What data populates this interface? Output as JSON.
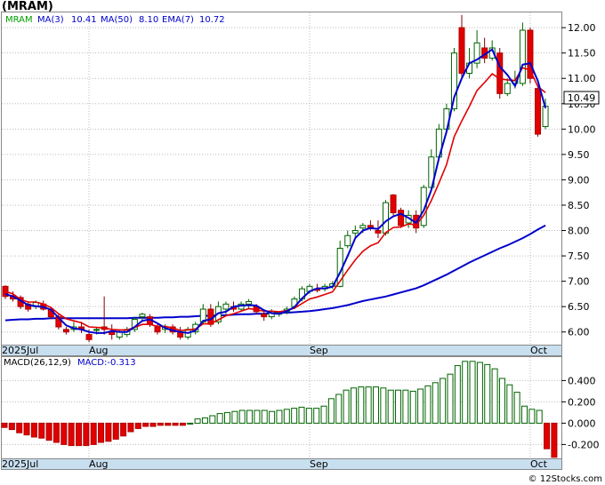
{
  "title": "(MRAM)",
  "watermark": "© 12Stocks.com",
  "colors": {
    "up": "#00a000",
    "down": "#e00000",
    "ma_fast": "#0000cc",
    "ma_slow": "#0000cc",
    "ema": "#e00000",
    "macd_pos": "#006400",
    "macd_neg": "#e00000",
    "axis_band": "#c8dff0",
    "grid": "#bbbbbb"
  },
  "chart_data": [
    {
      "type": "candlestick",
      "title": "(MRAM)",
      "legend": [
        {
          "label": "MRAM",
          "value": "",
          "color": "#00a000"
        },
        {
          "label": "MA(3)",
          "value": "10.41",
          "color": "#0000cc"
        },
        {
          "label": "MA(50)",
          "value": "8.10",
          "color": "#0000cc"
        },
        {
          "label": "EMA(7)",
          "value": "10.72",
          "color": "#0000cc"
        }
      ],
      "last_price": "10.49",
      "ylim": [
        5.75,
        12.3
      ],
      "y_ticks": [
        "6.00",
        "6.50",
        "7.00",
        "7.50",
        "8.00",
        "8.50",
        "9.00",
        "9.50",
        "10.00",
        "10.50",
        "11.00",
        "11.50",
        "12.00"
      ],
      "x_labels": [
        {
          "label": "2025Jul",
          "index": 0
        },
        {
          "label": "Aug",
          "index": 11
        },
        {
          "label": "Sep",
          "index": 40
        },
        {
          "label": "Oct",
          "index": 69
        }
      ],
      "ohlc": [
        [
          6.9,
          6.92,
          6.65,
          6.7
        ],
        [
          6.72,
          6.8,
          6.6,
          6.65
        ],
        [
          6.68,
          6.72,
          6.45,
          6.5
        ],
        [
          6.55,
          6.6,
          6.4,
          6.45
        ],
        [
          6.5,
          6.62,
          6.45,
          6.58
        ],
        [
          6.55,
          6.62,
          6.42,
          6.45
        ],
        [
          6.45,
          6.5,
          6.25,
          6.3
        ],
        [
          6.3,
          6.35,
          6.05,
          6.1
        ],
        [
          6.05,
          6.1,
          5.95,
          6.0
        ],
        [
          6.05,
          6.2,
          6.0,
          6.1
        ],
        [
          6.1,
          6.2,
          5.98,
          6.05
        ],
        [
          5.95,
          6.05,
          5.8,
          5.85
        ],
        [
          6.05,
          6.1,
          5.95,
          6.05
        ],
        [
          6.1,
          6.7,
          5.95,
          6.05
        ],
        [
          6.0,
          6.15,
          5.85,
          5.95
        ],
        [
          5.9,
          6.05,
          5.85,
          6.0
        ],
        [
          5.95,
          6.1,
          5.9,
          6.05
        ],
        [
          6.05,
          6.3,
          6.0,
          6.25
        ],
        [
          6.3,
          6.38,
          6.2,
          6.35
        ],
        [
          6.3,
          6.35,
          6.1,
          6.15
        ],
        [
          6.1,
          6.15,
          5.95,
          6.0
        ],
        [
          6.05,
          6.15,
          5.98,
          6.1
        ],
        [
          6.1,
          6.15,
          5.95,
          6.0
        ],
        [
          6.0,
          6.1,
          5.85,
          5.9
        ],
        [
          5.9,
          6.1,
          5.85,
          6.05
        ],
        [
          6.0,
          6.2,
          5.95,
          6.15
        ],
        [
          6.2,
          6.55,
          6.15,
          6.45
        ],
        [
          6.45,
          6.55,
          6.1,
          6.15
        ],
        [
          6.2,
          6.6,
          6.15,
          6.5
        ],
        [
          6.45,
          6.6,
          6.35,
          6.55
        ],
        [
          6.5,
          6.6,
          6.4,
          6.45
        ],
        [
          6.45,
          6.6,
          6.4,
          6.55
        ],
        [
          6.55,
          6.65,
          6.45,
          6.6
        ],
        [
          6.5,
          6.55,
          6.35,
          6.4
        ],
        [
          6.35,
          6.4,
          6.22,
          6.3
        ],
        [
          6.3,
          6.45,
          6.25,
          6.4
        ],
        [
          6.35,
          6.4,
          6.3,
          6.38
        ],
        [
          6.4,
          6.5,
          6.35,
          6.45
        ],
        [
          6.5,
          6.7,
          6.45,
          6.65
        ],
        [
          6.65,
          6.9,
          6.6,
          6.85
        ],
        [
          6.8,
          6.95,
          6.75,
          6.9
        ],
        [
          6.85,
          6.95,
          6.78,
          6.82
        ],
        [
          6.85,
          6.95,
          6.8,
          6.9
        ],
        [
          6.9,
          7.0,
          6.85,
          6.95
        ],
        [
          6.9,
          7.8,
          6.88,
          7.65
        ],
        [
          7.7,
          8.0,
          7.65,
          7.9
        ],
        [
          7.95,
          8.1,
          7.85,
          8.0
        ],
        [
          8.05,
          8.15,
          7.95,
          8.1
        ],
        [
          8.1,
          8.2,
          8.0,
          8.05
        ],
        [
          8.0,
          8.2,
          7.85,
          7.95
        ],
        [
          7.95,
          8.6,
          7.9,
          8.55
        ],
        [
          8.7,
          8.72,
          8.3,
          8.35
        ],
        [
          8.4,
          8.45,
          8.05,
          8.1
        ],
        [
          8.15,
          8.4,
          8.05,
          8.3
        ],
        [
          8.3,
          8.4,
          7.95,
          8.05
        ],
        [
          8.1,
          8.9,
          8.05,
          8.85
        ],
        [
          8.85,
          9.6,
          8.8,
          9.45
        ],
        [
          9.45,
          10.1,
          9.4,
          10.0
        ],
        [
          10.0,
          10.5,
          9.95,
          10.4
        ],
        [
          10.4,
          11.6,
          10.35,
          11.5
        ],
        [
          12.0,
          12.25,
          11.0,
          11.1
        ],
        [
          11.1,
          11.6,
          11.0,
          11.3
        ],
        [
          11.3,
          11.95,
          11.2,
          11.7
        ],
        [
          11.6,
          11.8,
          11.3,
          11.4
        ],
        [
          11.4,
          11.75,
          11.35,
          11.6
        ],
        [
          11.5,
          11.6,
          10.6,
          10.7
        ],
        [
          10.7,
          11.0,
          10.65,
          10.9
        ],
        [
          10.9,
          11.15,
          10.8,
          10.95
        ],
        [
          10.9,
          12.1,
          10.85,
          11.95
        ],
        [
          11.95,
          12.0,
          10.9,
          11.0
        ],
        [
          10.8,
          10.85,
          9.85,
          9.9
        ],
        [
          10.05,
          10.6,
          10.0,
          10.45
        ]
      ],
      "ma_fast": [
        6.75,
        6.7,
        6.62,
        6.53,
        6.51,
        6.49,
        6.44,
        6.28,
        6.13,
        6.07,
        6.05,
        6.0,
        5.98,
        5.98,
        6.02,
        6.0,
        6.0,
        6.1,
        6.22,
        6.25,
        6.17,
        6.08,
        6.03,
        6.0,
        5.98,
        6.03,
        6.22,
        6.25,
        6.37,
        6.4,
        6.5,
        6.52,
        6.53,
        6.52,
        6.43,
        6.37,
        6.36,
        6.41,
        6.49,
        6.66,
        6.8,
        6.86,
        6.86,
        6.89,
        7.17,
        7.5,
        7.85,
        8.0,
        8.05,
        8.03,
        8.18,
        8.28,
        8.33,
        8.25,
        8.15,
        8.4,
        8.8,
        9.43,
        9.95,
        10.63,
        11.0,
        11.3,
        11.37,
        11.47,
        11.57,
        11.23,
        11.07,
        10.85,
        11.27,
        11.3,
        10.95,
        10.41
      ],
      "ma_slow": [
        6.23,
        6.24,
        6.25,
        6.25,
        6.26,
        6.26,
        6.27,
        6.27,
        6.27,
        6.27,
        6.27,
        6.27,
        6.27,
        6.27,
        6.27,
        6.27,
        6.27,
        6.28,
        6.28,
        6.28,
        6.28,
        6.29,
        6.29,
        6.3,
        6.3,
        6.31,
        6.32,
        6.32,
        6.33,
        6.33,
        6.34,
        6.35,
        6.35,
        6.36,
        6.36,
        6.37,
        6.38,
        6.38,
        6.39,
        6.4,
        6.41,
        6.43,
        6.45,
        6.47,
        6.5,
        6.53,
        6.57,
        6.61,
        6.64,
        6.67,
        6.7,
        6.74,
        6.78,
        6.82,
        6.86,
        6.92,
        6.99,
        7.06,
        7.13,
        7.21,
        7.29,
        7.37,
        7.44,
        7.51,
        7.58,
        7.65,
        7.71,
        7.78,
        7.85,
        7.93,
        8.02,
        8.1
      ],
      "ema": [
        6.8,
        6.75,
        6.64,
        6.59,
        6.59,
        6.55,
        6.48,
        6.36,
        6.26,
        6.22,
        6.18,
        6.1,
        6.09,
        6.08,
        6.05,
        6.04,
        6.04,
        6.09,
        6.15,
        6.15,
        6.11,
        6.11,
        6.08,
        6.03,
        6.04,
        6.06,
        6.16,
        6.16,
        6.24,
        6.32,
        6.36,
        6.41,
        6.46,
        6.44,
        6.41,
        6.41,
        6.4,
        6.42,
        6.47,
        6.56,
        6.65,
        6.69,
        6.74,
        6.79,
        7.0,
        7.22,
        7.42,
        7.59,
        7.7,
        7.76,
        7.96,
        8.06,
        8.07,
        8.13,
        8.11,
        8.3,
        8.59,
        8.94,
        9.3,
        9.85,
        10.16,
        10.45,
        10.76,
        10.92,
        11.09,
        10.99,
        10.97,
        10.96,
        11.21,
        11.16,
        10.84,
        10.72
      ],
      "macd": {
        "label": "MACD(26,12,9)",
        "value_label": "MACD:-0.313",
        "ylim": [
          -0.33,
          0.62
        ],
        "y_ticks": [
          "-0.200",
          "0.000",
          "0.200",
          "0.400"
        ],
        "x_labels": [
          {
            "label": "2025Jul",
            "index": 0
          },
          {
            "label": "Aug",
            "index": 11
          },
          {
            "label": "Sep",
            "index": 40
          },
          {
            "label": "Oct",
            "index": 69
          }
        ],
        "values": [
          -0.04,
          -0.06,
          -0.09,
          -0.11,
          -0.13,
          -0.14,
          -0.16,
          -0.18,
          -0.2,
          -0.21,
          -0.21,
          -0.21,
          -0.2,
          -0.18,
          -0.17,
          -0.15,
          -0.12,
          -0.08,
          -0.05,
          -0.03,
          -0.03,
          -0.02,
          -0.02,
          -0.02,
          -0.02,
          0.0,
          0.04,
          0.05,
          0.07,
          0.09,
          0.1,
          0.11,
          0.12,
          0.12,
          0.12,
          0.12,
          0.11,
          0.12,
          0.13,
          0.14,
          0.15,
          0.14,
          0.14,
          0.16,
          0.23,
          0.27,
          0.31,
          0.33,
          0.34,
          0.34,
          0.34,
          0.33,
          0.31,
          0.31,
          0.31,
          0.3,
          0.32,
          0.35,
          0.38,
          0.42,
          0.46,
          0.54,
          0.58,
          0.58,
          0.57,
          0.55,
          0.51,
          0.42,
          0.36,
          0.29,
          0.16,
          0.13,
          0.12,
          -0.24,
          -0.32
        ]
      }
    }
  ]
}
